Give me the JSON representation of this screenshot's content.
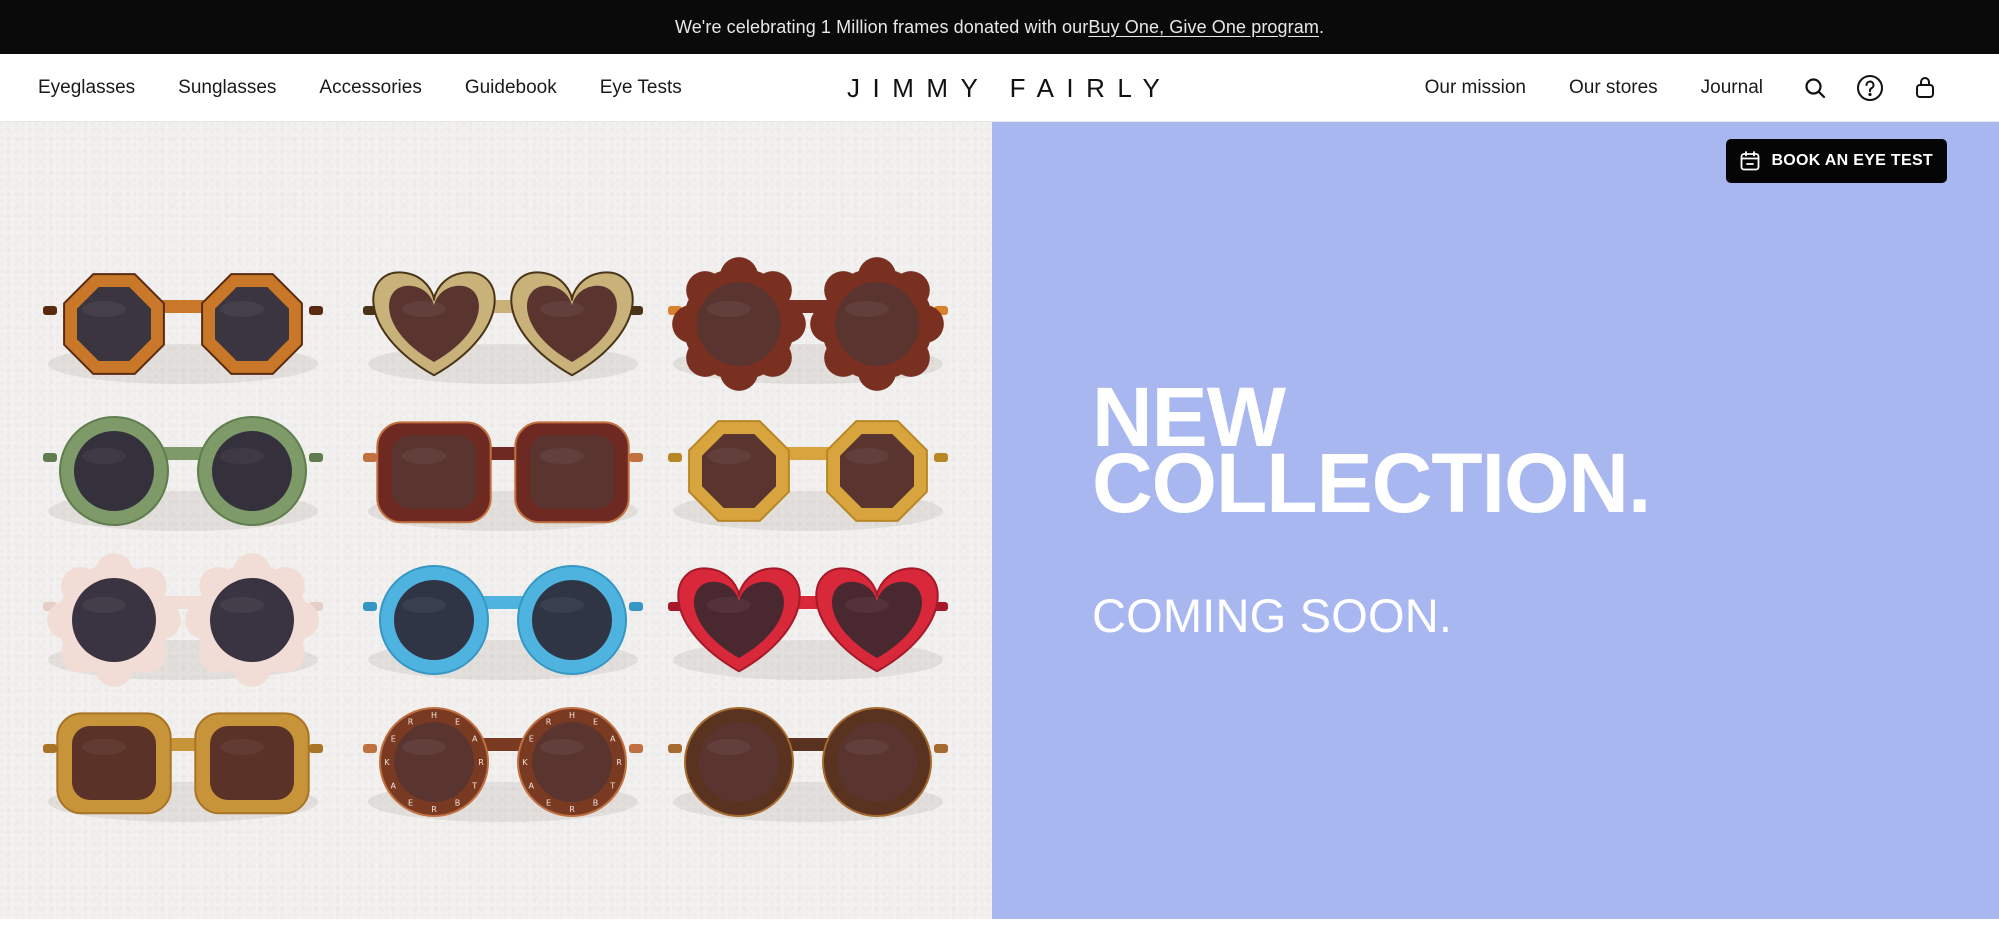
{
  "announcement": {
    "prefix": "We're celebrating 1 Million frames donated with our ",
    "link_text": "Buy One, Give One program",
    "suffix": "."
  },
  "nav": {
    "left_links": [
      {
        "label": "Eyeglasses"
      },
      {
        "label": "Sunglasses"
      },
      {
        "label": "Accessories"
      },
      {
        "label": "Guidebook"
      },
      {
        "label": "Eye Tests"
      }
    ],
    "logo": "JIMMY FAIRLY",
    "right_links": [
      {
        "label": "Our mission"
      },
      {
        "label": "Our stores"
      },
      {
        "label": "Journal"
      }
    ],
    "icons": [
      {
        "name": "search-icon"
      },
      {
        "name": "help-icon"
      },
      {
        "name": "shopping-bag-icon"
      }
    ]
  },
  "hero": {
    "book_button": {
      "label": "BOOK AN EYE TEST",
      "icon": "calendar-icon"
    },
    "headline_lines": [
      "NEW",
      "COLLECTION."
    ],
    "subheadline": "COMING SOON.",
    "panel_color": "#a9b7f1",
    "image": {
      "description": "Flat-lay of 12 children's sunglasses on white paper",
      "sunglasses": [
        {
          "shape": "octagon",
          "frame": "#c9782a",
          "accent": "#5a2a10",
          "lens": "#3b3540"
        },
        {
          "shape": "heart",
          "frame": "#c8b27a",
          "accent": "#4a3418",
          "lens": "#5a3530"
        },
        {
          "shape": "flower",
          "frame": "#7a3020",
          "accent": "#d9822e",
          "lens": "#5a3530"
        },
        {
          "shape": "round",
          "frame": "#7d9a68",
          "accent": "#5f7d4e",
          "lens": "#34303c"
        },
        {
          "shape": "cat",
          "frame": "#6e2a22",
          "accent": "#c27040",
          "lens": "#5a3530"
        },
        {
          "shape": "octagon",
          "frame": "#d7a43e",
          "accent": "#b98626",
          "lens": "#5a3530"
        },
        {
          "shape": "flower",
          "frame": "#f1ddd6",
          "accent": "#e6cfc6",
          "lens": "#3a3442"
        },
        {
          "shape": "round",
          "frame": "#4fb3e0",
          "accent": "#3697c4",
          "lens": "#2f3545"
        },
        {
          "shape": "heart",
          "frame": "#d8283a",
          "accent": "#a51a28",
          "lens": "#4a2830"
        },
        {
          "shape": "square",
          "frame": "#c8943a",
          "accent": "#a87426",
          "lens": "#5a3228"
        },
        {
          "shape": "round-letters",
          "frame": "#7a3a22",
          "accent": "#c07040",
          "lens": "#5a3530",
          "letters": "HEARTBREAKER"
        },
        {
          "shape": "round",
          "frame": "#5a3220",
          "accent": "#a56a30",
          "lens": "#5a3530"
        }
      ]
    }
  }
}
